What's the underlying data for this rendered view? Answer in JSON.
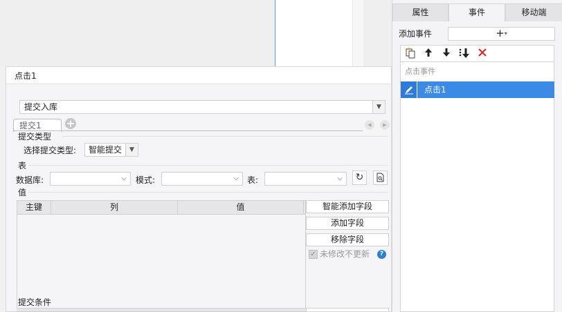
{
  "right_panel": {
    "tabs": [
      {
        "label": "属性"
      },
      {
        "label": "事件"
      },
      {
        "label": "移动端"
      }
    ],
    "add_event_label": "添加事件",
    "add_event_button": "+",
    "toolbar_icons": [
      "copy-icon",
      "move-up-icon",
      "move-down-icon",
      "move-bottom-icon",
      "delete-icon"
    ],
    "event_list_header": "点击事件",
    "events": [
      {
        "label": "点击1",
        "selected": true
      }
    ],
    "selected_color": "#3b8ae6"
  },
  "dialog": {
    "title": "点击1",
    "type_select": {
      "value": "提交入库"
    },
    "tabs": [
      {
        "label": "提交1"
      }
    ],
    "submit_type_section": "提交类型",
    "submit_type_label": "选择提交类型:",
    "submit_type_value": "智能提交",
    "table_section": "表",
    "database_label": "数据库:",
    "database_value": "",
    "schema_label": "模式:",
    "schema_value": "",
    "table_label": "表:",
    "table_value": "",
    "value_section": "值",
    "columns": [
      "主键",
      "列",
      "值"
    ],
    "buttons": {
      "smart_add": "智能添加字段",
      "add_field": "添加字段",
      "remove_field": "移除字段"
    },
    "no_update_label": "未修改不更新",
    "no_update_checked": true,
    "help_icon": "?",
    "submit_condition_section": "提交条件"
  }
}
